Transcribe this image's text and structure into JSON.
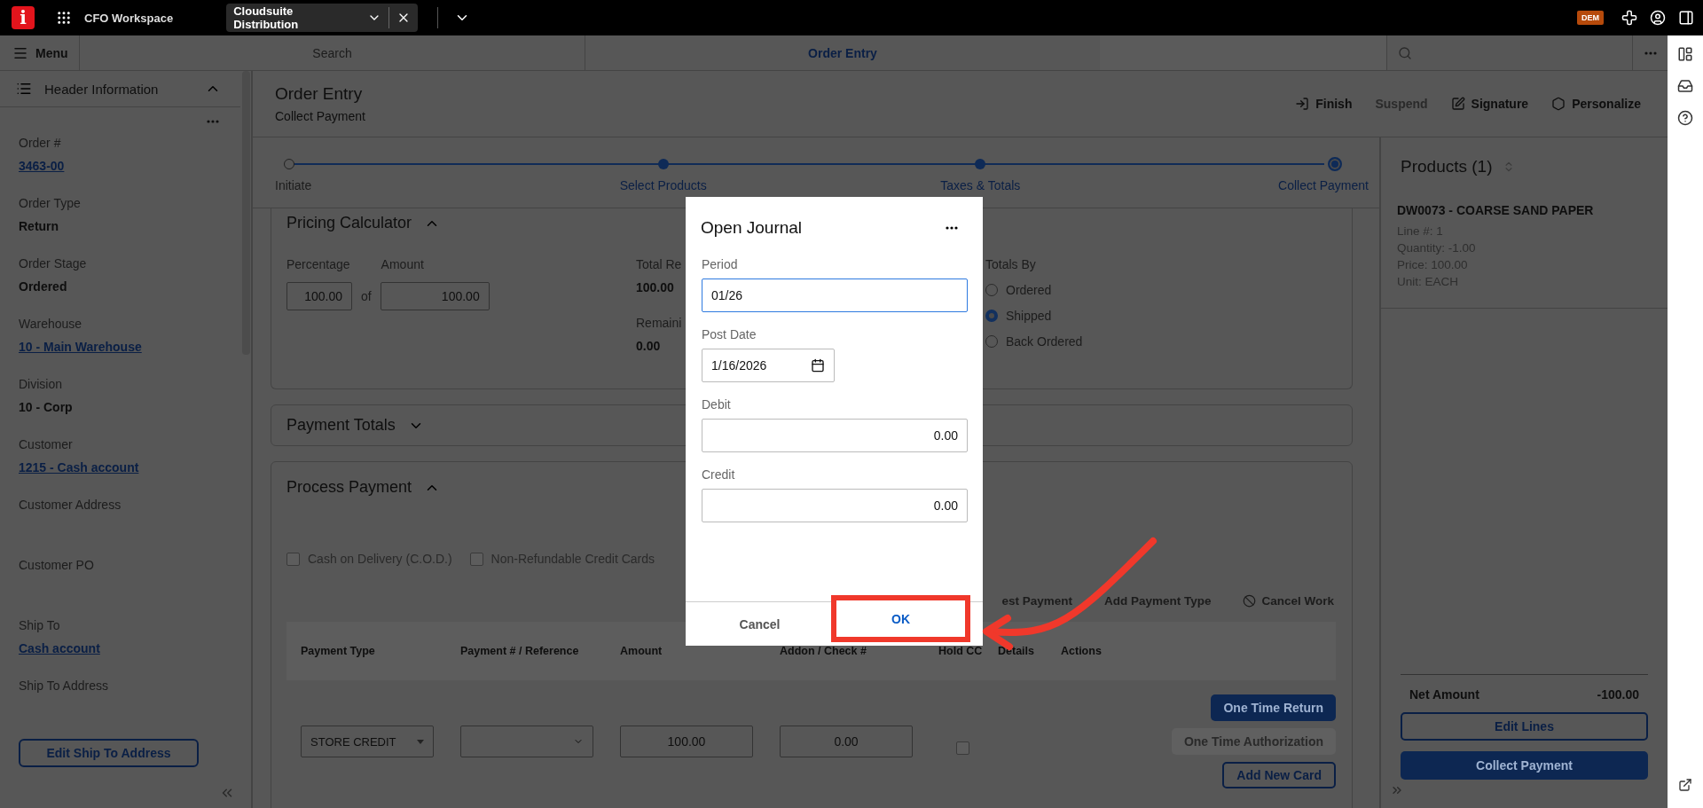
{
  "top_bar": {
    "logo": "i",
    "workspace": "CFO Workspace",
    "tab": "Cloudsuite Distribution",
    "badge": "DEM"
  },
  "nav": {
    "menu": "Menu",
    "search": "Search",
    "current": "Order Entry"
  },
  "sidebar": {
    "title": "Header Information",
    "expanded": true,
    "fields": [
      {
        "label": "Order #",
        "value": "3463-00",
        "kind": "link"
      },
      {
        "label": "Order Type",
        "value": "Return",
        "kind": "bold"
      },
      {
        "label": "Order Stage",
        "value": "Ordered",
        "kind": "bold"
      },
      {
        "label": "Warehouse",
        "value": "10 - Main Warehouse",
        "kind": "link"
      },
      {
        "label": "Division",
        "value": "10 - Corp",
        "kind": "bold"
      },
      {
        "label": "Customer",
        "value": "1215 - Cash account",
        "kind": "link"
      },
      {
        "label": "Customer Address",
        "kind": "empty"
      },
      {
        "label": "Customer PO",
        "kind": "empty"
      },
      {
        "label": "Ship To",
        "value": "Cash account",
        "kind": "link"
      },
      {
        "label": "Ship To Address",
        "kind": "empty"
      }
    ],
    "button": "Edit Ship To Address"
  },
  "page": {
    "title": "Order Entry",
    "subtitle": "Collect Payment",
    "actions": [
      {
        "label": "Finish",
        "disabled": false
      },
      {
        "label": "Suspend",
        "disabled": true
      },
      {
        "label": "Signature",
        "disabled": false
      },
      {
        "label": "Personalize",
        "disabled": false
      }
    ]
  },
  "stepper": [
    {
      "label": "Initiate",
      "completed": false,
      "selected": false
    },
    {
      "label": "Select Products",
      "completed": true,
      "selected": false
    },
    {
      "label": "Taxes & Totals",
      "completed": true,
      "selected": false
    },
    {
      "label": "Collect Payment",
      "completed": true,
      "selected": true
    }
  ],
  "pricing_calculator": {
    "title": "Pricing Calculator",
    "expanded": true,
    "percentage": {
      "label": "Percentage",
      "value": "100.00"
    },
    "of": "of",
    "amount": {
      "label": "Amount",
      "value": "100.00"
    },
    "totals": [
      {
        "label": "Total Re",
        "value": "100.00"
      },
      {
        "label": "Remaini",
        "value": "0.00"
      }
    ],
    "totals_by": {
      "label": "Totals By",
      "options": [
        {
          "label": "Ordered",
          "selected": false
        },
        {
          "label": "Shipped",
          "selected": true
        },
        {
          "label": "Back Ordered",
          "selected": false
        }
      ]
    }
  },
  "payment_totals": {
    "title": "Payment Totals",
    "expanded": false
  },
  "process_payment": {
    "title": "Process Payment",
    "expanded": true,
    "options": [
      {
        "label": "Cash on Delivery (C.O.D.)",
        "checked": false
      },
      {
        "label": "Non-Refundable Credit Cards",
        "checked": false
      }
    ],
    "actions": [
      {
        "label": "est Payment",
        "kind": "text"
      },
      {
        "label": "Add Payment Type",
        "kind": "text"
      },
      {
        "label": "Cancel Work",
        "kind": "cancel"
      }
    ],
    "table": {
      "columns": [
        "Payment Type",
        "Payment # / Reference",
        "Amount",
        "Addon / Check #",
        "Hold CC",
        "Details",
        "Actions"
      ],
      "rows": [
        {
          "payment_type": "STORE CREDIT",
          "amount": "100.00",
          "addon": "0.00",
          "hold_cc": false,
          "buttons": [
            {
              "label": "One Time Return",
              "kind": "primary"
            },
            {
              "label": "One Time Authorization",
              "kind": "disabled"
            },
            {
              "label": "Add New Card",
              "kind": "outline"
            }
          ]
        }
      ]
    }
  },
  "products": {
    "title": "Products (1)",
    "items": [
      {
        "name": "DW0073 - COARSE SAND PAPER",
        "details": [
          "Line #: 1",
          "Quantity: -1.00",
          "Price: 100.00",
          "Unit: EACH"
        ]
      }
    ],
    "net_label": "Net Amount",
    "net_value": "-100.00",
    "buttons": [
      {
        "label": "Edit Lines",
        "kind": "outline"
      },
      {
        "label": "Collect Payment",
        "kind": "primary"
      }
    ]
  },
  "modal": {
    "title": "Open Journal",
    "fields": [
      {
        "label": "Period",
        "value": "01/26",
        "kind": "text",
        "focused": true
      },
      {
        "label": "Post Date",
        "value": "1/16/2026",
        "kind": "date",
        "focused": false
      },
      {
        "label": "Debit",
        "value": "0.00",
        "kind": "number",
        "focused": false
      },
      {
        "label": "Credit",
        "value": "0.00",
        "kind": "number",
        "focused": false
      }
    ],
    "buttons": [
      {
        "label": "Cancel",
        "primary": false
      },
      {
        "label": "OK",
        "primary": true
      }
    ]
  }
}
